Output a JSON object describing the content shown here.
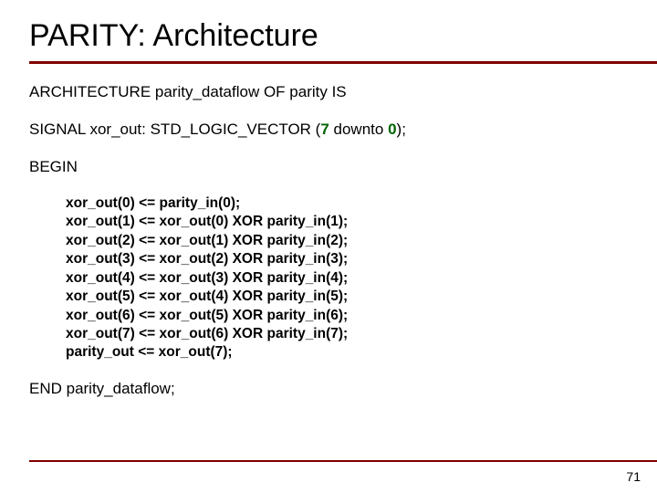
{
  "title": "PARITY: Architecture",
  "arch_line": "ARCHITECTURE parity_dataflow OF parity IS",
  "signal": {
    "pre": "SIGNAL xor_out: STD_LOGIC_VECTOR (",
    "hi": "7",
    "mid": " downto ",
    "lo": "0",
    "post": ");"
  },
  "begin": "BEGIN",
  "code_lines": [
    "xor_out(0) <= parity_in(0);",
    "xor_out(1) <= xor_out(0) XOR parity_in(1);",
    "xor_out(2) <= xor_out(1) XOR parity_in(2);",
    "xor_out(3) <= xor_out(2) XOR parity_in(3);",
    "xor_out(4) <= xor_out(3) XOR parity_in(4);",
    "xor_out(5) <= xor_out(4) XOR parity_in(5);",
    "xor_out(6) <= xor_out(5) XOR parity_in(6);",
    "xor_out(7) <= xor_out(6) XOR parity_in(7);",
    "parity_out <= xor_out(7);"
  ],
  "end_line": "END parity_dataflow;",
  "page_number": "71"
}
